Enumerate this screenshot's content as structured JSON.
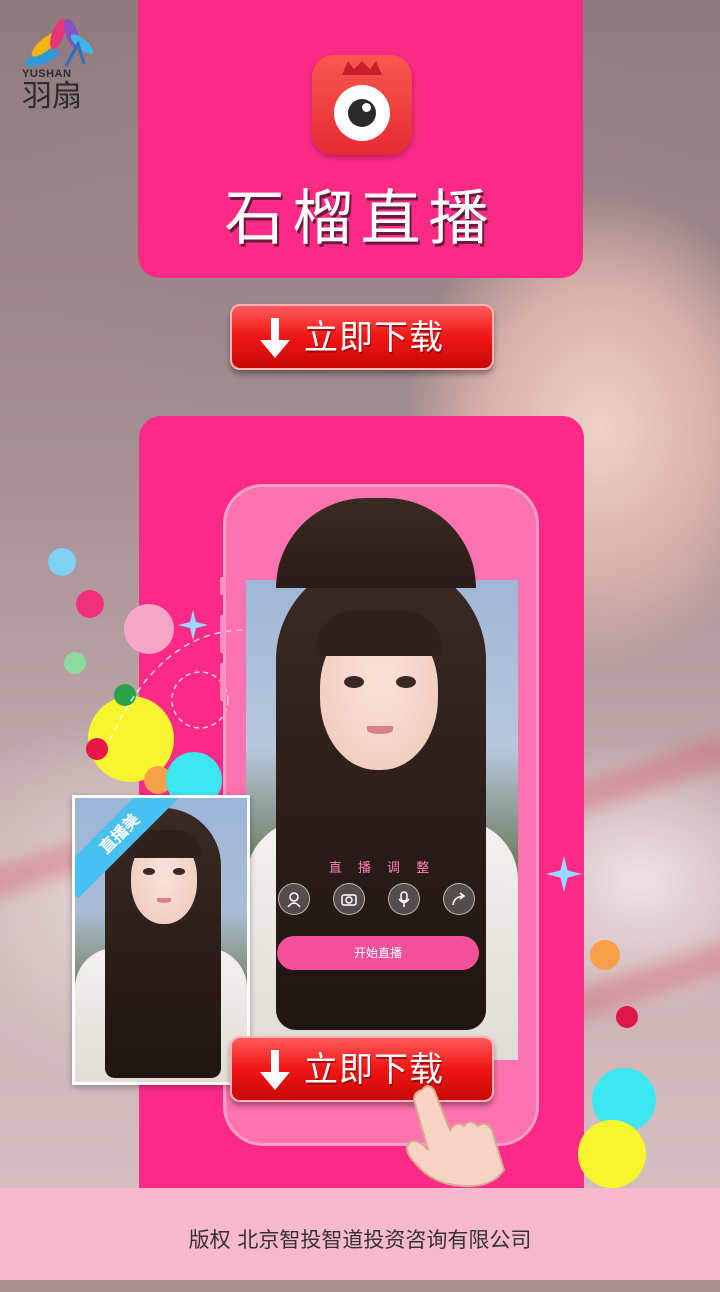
{
  "logo": {
    "sub": "YUSHAN",
    "main": "羽扇"
  },
  "app": {
    "name": "石榴直播"
  },
  "download_button": {
    "label": "立即下载"
  },
  "phone_screen": {
    "live_adjust": "直 播 调 整",
    "start_live": "开始直播",
    "controls": [
      "beauty-icon",
      "camera-switch-icon",
      "microphone-icon",
      "share-icon"
    ]
  },
  "preview": {
    "ribbon": "直播美"
  },
  "footer": {
    "copyright": "版权  北京智投智道投资咨询有限公司"
  },
  "colors": {
    "brand_pink": "#fb2a86",
    "button_red": "#f01515",
    "footer_pink": "#f8b8cd"
  }
}
